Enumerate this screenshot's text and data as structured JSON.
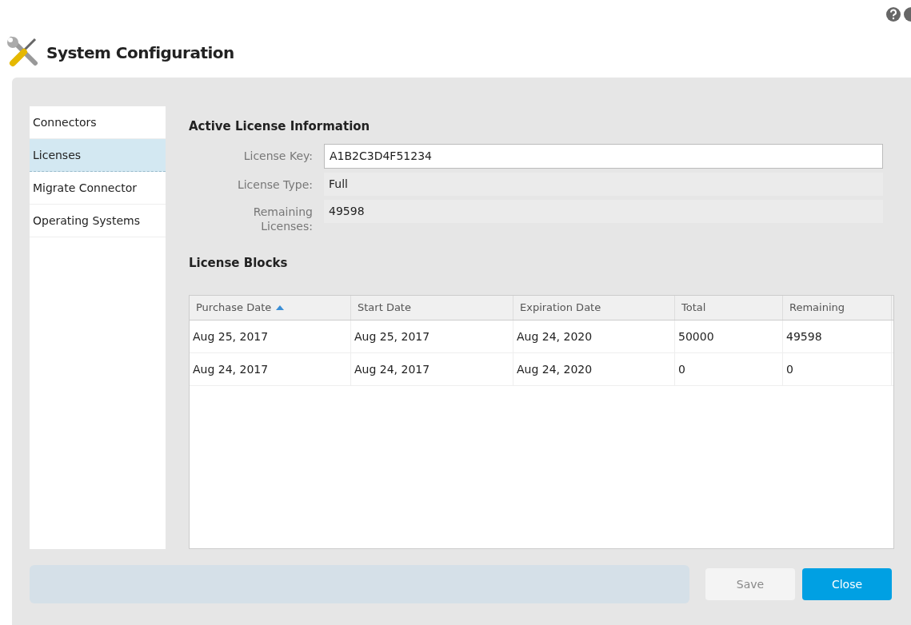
{
  "header": {
    "title": "System Configuration"
  },
  "sidebar": {
    "items": [
      {
        "label": "Connectors",
        "selected": false
      },
      {
        "label": "Licenses",
        "selected": true
      },
      {
        "label": "Migrate Connector",
        "selected": false
      },
      {
        "label": "Operating Systems",
        "selected": false
      }
    ]
  },
  "active_license": {
    "heading": "Active License Information",
    "fields": [
      {
        "kind": "input",
        "label": "License Key:",
        "value": "A1B2C3D4F51234"
      },
      {
        "kind": "readonly",
        "label": "License Type:",
        "value": "Full"
      },
      {
        "kind": "readonly",
        "label": "Remaining Licenses:",
        "value": "49598"
      }
    ]
  },
  "license_blocks": {
    "heading": "License Blocks",
    "columns": [
      {
        "label": "Purchase Date",
        "sorted": true
      },
      {
        "label": "Start Date",
        "sorted": false
      },
      {
        "label": "Expiration Date",
        "sorted": false
      },
      {
        "label": "Total",
        "sorted": false
      },
      {
        "label": "Remaining",
        "sorted": false
      }
    ],
    "rows": [
      [
        "Aug 25, 2017",
        "Aug 25, 2017",
        "Aug 24, 2020",
        "50000",
        "49598"
      ],
      [
        "Aug 24, 2017",
        "Aug 24, 2017",
        "Aug 24, 2020",
        "0",
        "0"
      ]
    ]
  },
  "buttons": [
    {
      "label": "Save",
      "disabled": true
    },
    {
      "label": "Close",
      "disabled": false
    }
  ]
}
